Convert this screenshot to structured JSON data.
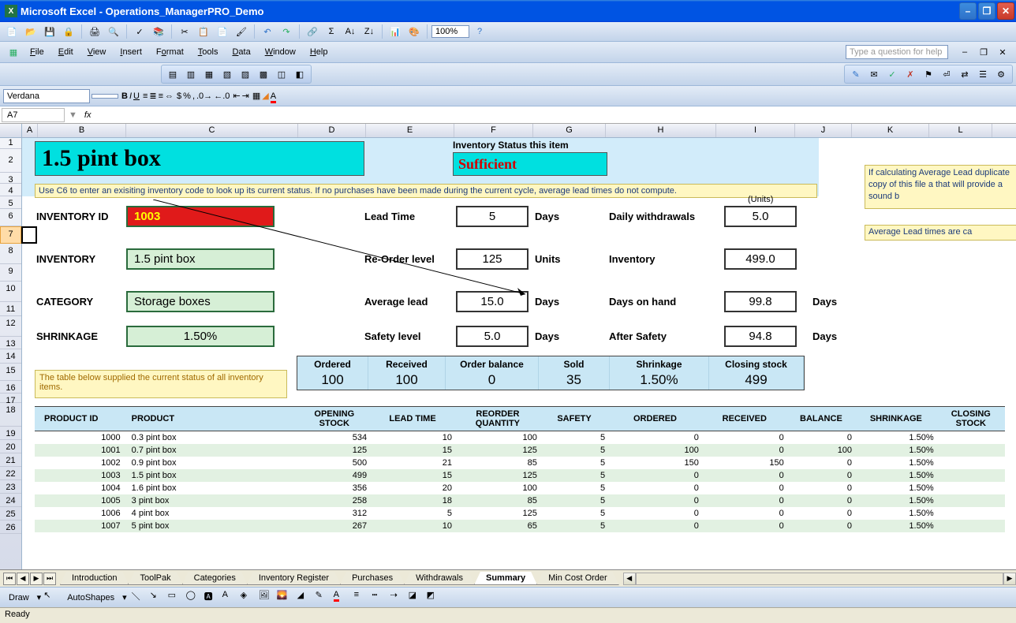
{
  "window": {
    "title": "Microsoft Excel - Operations_ManagerPRO_Demo"
  },
  "menus": [
    "File",
    "Edit",
    "View",
    "Insert",
    "Format",
    "Tools",
    "Data",
    "Window",
    "Help"
  ],
  "help_placeholder": "Type a question for help",
  "zoom": "100%",
  "font_name": "Verdana",
  "font_size": "",
  "name_box": "A7",
  "columns": [
    "A",
    "B",
    "C",
    "D",
    "E",
    "F",
    "G",
    "H",
    "I",
    "J",
    "K",
    "L"
  ],
  "rows_left": [
    "1",
    "2",
    "3",
    "4",
    "5",
    "6",
    "7",
    "8",
    "9",
    "10",
    "11",
    "12",
    "13",
    "14",
    "15",
    "16",
    "17",
    "18",
    "19",
    "20",
    "21",
    "22",
    "23",
    "24",
    "25",
    "26"
  ],
  "sheet": {
    "big_title": "1.5 pint box",
    "inv_status_label": "Inventory Status this item",
    "inv_status_value": "Sufficient",
    "units_label": "(Units)",
    "help1": "Use C6 to enter an exisiting inventory code to look up its current status. If no purchases have been made during the current cycle, average lead times do not compute.",
    "help2": "If calculating Average Lead duplicate copy of this file a that will provide a sound b",
    "help3": "Average Lead times are ca",
    "labels": {
      "inventory_id": "INVENTORY ID",
      "inventory": "INVENTORY",
      "category": "CATEGORY",
      "shrinkage": "SHRINKAGE",
      "lead_time": "Lead Time",
      "reorder_level": "Re-Order level",
      "average_lead": "Average lead",
      "safety_level": "Safety level",
      "daily_withdrawals": "Daily withdrawals",
      "inventory_right": "Inventory",
      "days_on_hand": "Days on hand",
      "after_safety": "After Safety",
      "days": "Days",
      "units": "Units"
    },
    "values": {
      "inventory_id": "1003",
      "inventory": "1.5 pint box",
      "category": "Storage boxes",
      "shrinkage": "1.50%",
      "lead_time": "5",
      "reorder_level": "125",
      "average_lead": "15.0",
      "safety_level": "5.0",
      "daily_withdrawals": "5.0",
      "inventory_right": "499.0",
      "days_on_hand": "99.8",
      "after_safety": "94.8"
    },
    "summary_headers": [
      "Ordered",
      "Received",
      "Order balance",
      "Sold",
      "Shrinkage",
      "Closing stock"
    ],
    "summary_values": [
      "100",
      "100",
      "0",
      "35",
      "1.50%",
      "499"
    ],
    "table_note": "The table below supplied the current status of all inventory items.",
    "table_headers": [
      "PRODUCT ID",
      "PRODUCT",
      "OPENING STOCK",
      "LEAD TIME",
      "REORDER QUANTITY",
      "SAFETY",
      "ORDERED",
      "RECEIVED",
      "BALANCE",
      "SHRINKAGE",
      "CLOSING STOCK"
    ],
    "table_rows": [
      [
        "1000",
        "0.3 pint box",
        "534",
        "10",
        "100",
        "5",
        "0",
        "0",
        "0",
        "1.50%",
        ""
      ],
      [
        "1001",
        "0.7 pint box",
        "125",
        "15",
        "125",
        "5",
        "100",
        "0",
        "100",
        "1.50%",
        ""
      ],
      [
        "1002",
        "0.9 pint box",
        "500",
        "21",
        "85",
        "5",
        "150",
        "150",
        "0",
        "1.50%",
        ""
      ],
      [
        "1003",
        "1.5 pint box",
        "499",
        "15",
        "125",
        "5",
        "0",
        "0",
        "0",
        "1.50%",
        ""
      ],
      [
        "1004",
        "1.6 pint box",
        "356",
        "20",
        "100",
        "5",
        "0",
        "0",
        "0",
        "1.50%",
        ""
      ],
      [
        "1005",
        "3 pint box",
        "258",
        "18",
        "85",
        "5",
        "0",
        "0",
        "0",
        "1.50%",
        ""
      ],
      [
        "1006",
        "4 pint box",
        "312",
        "5",
        "125",
        "5",
        "0",
        "0",
        "0",
        "1.50%",
        ""
      ],
      [
        "1007",
        "5 pint box",
        "267",
        "10",
        "65",
        "5",
        "0",
        "0",
        "0",
        "1.50%",
        ""
      ]
    ]
  },
  "tabs": [
    "Introduction",
    "ToolPak",
    "Categories",
    "Inventory Register",
    "Purchases",
    "Withdrawals",
    "Summary",
    "Min Cost Order"
  ],
  "active_tab": "Summary",
  "draw_label": "Draw",
  "autoshapes_label": "AutoShapes",
  "status_text": "Ready"
}
